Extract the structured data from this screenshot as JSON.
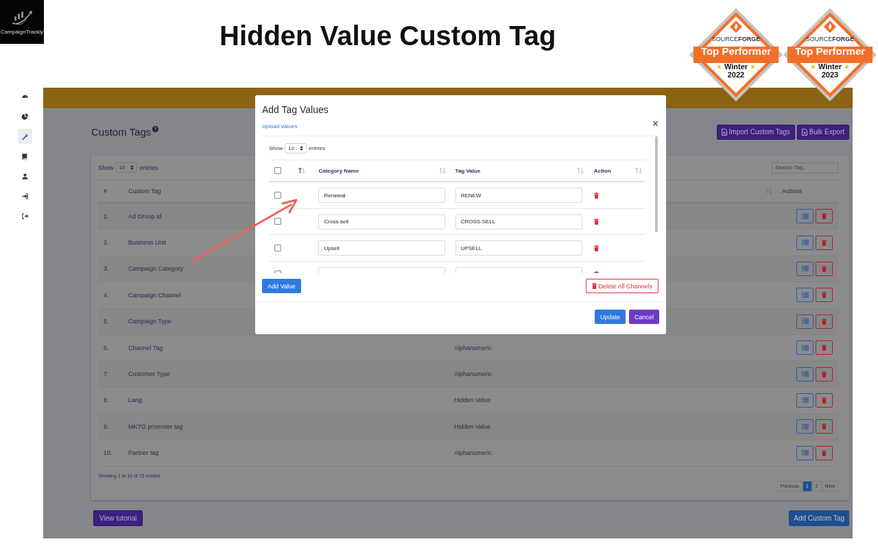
{
  "header": {
    "logo_text": "CampaignTrackly",
    "title": "Hidden Value Custom Tag"
  },
  "badges": [
    {
      "brand": "SOURCE**FORGE**",
      "title": "Top Performer",
      "season": "Winter",
      "year": "2022"
    },
    {
      "brand": "SOURCE**FORGE**",
      "title": "Top Performer",
      "season": "Winter",
      "year": "2023"
    }
  ],
  "sidebar": {
    "items": [
      {
        "kind": "dashboard",
        "selected": false
      },
      {
        "kind": "chart",
        "selected": false
      },
      {
        "kind": "wrench",
        "selected": true
      },
      {
        "kind": "book",
        "selected": false
      },
      {
        "kind": "user",
        "selected": false
      },
      {
        "kind": "login",
        "selected": false
      },
      {
        "kind": "logout",
        "selected": false
      }
    ]
  },
  "page": {
    "heading": "Custom Tags",
    "buttons": [
      "Import Custom Tags",
      "Bulk Export"
    ],
    "length": {
      "show": "Show",
      "value": "10",
      "entries": "entries"
    },
    "search": {
      "placeholder": "Search Tag.."
    },
    "table": {
      "columns": [
        "#",
        "Custom Tag",
        "Actions"
      ],
      "rows": [
        {
          "index": "1.",
          "name": "Ad Group Id"
        },
        {
          "index": "2.",
          "name": "Business Unit"
        },
        {
          "index": "3.",
          "name": "Campaign Category"
        },
        {
          "index": "4.",
          "name": "Campaign Channel"
        },
        {
          "index": "5.",
          "name": "Campaign Type"
        },
        {
          "index": "6.",
          "name": "Channel Tag",
          "type": "Alphanumeric"
        },
        {
          "index": "7.",
          "name": "Customer Type",
          "type": "Alphanumeric"
        },
        {
          "index": "8.",
          "name": "Lang",
          "type": "Hidden Value"
        },
        {
          "index": "9.",
          "name": "MKTG promoter tag",
          "type": "Hidden Value"
        },
        {
          "index": "10.",
          "name": "Partner tag",
          "type": "Alphanumeric"
        }
      ]
    },
    "info": "Showing 1 to 10 of 15 entries",
    "pagination": [
      {
        "label": "Previous",
        "selected": false
      },
      {
        "label": "1",
        "selected": true
      },
      {
        "label": "2",
        "selected": false
      },
      {
        "label": "Next",
        "selected": false
      }
    ],
    "tutorial_button": "View tutorial",
    "add_button": "Add Custom Tag"
  },
  "modal": {
    "title": "Add Tag Values",
    "link": "Upload Values",
    "length": {
      "show": "Show",
      "value": "10",
      "entries": "entries"
    },
    "select_all_checked": false,
    "columns": [
      "Category Name",
      "Tag Value",
      "Action"
    ],
    "rows": [
      {
        "checked": false,
        "category_name": "Renewal",
        "tag_value": "RENEW"
      },
      {
        "checked": false,
        "category_name": "Cross-sell",
        "tag_value": "CROSS-SELL"
      },
      {
        "checked": false,
        "category_name": "Upsell",
        "tag_value": "UPSELL"
      },
      {
        "checked": false
      }
    ],
    "add_button": "Add Value",
    "delete_button": "Delete All Channels",
    "update_button": "Update",
    "cancel_button": "Cancel"
  }
}
